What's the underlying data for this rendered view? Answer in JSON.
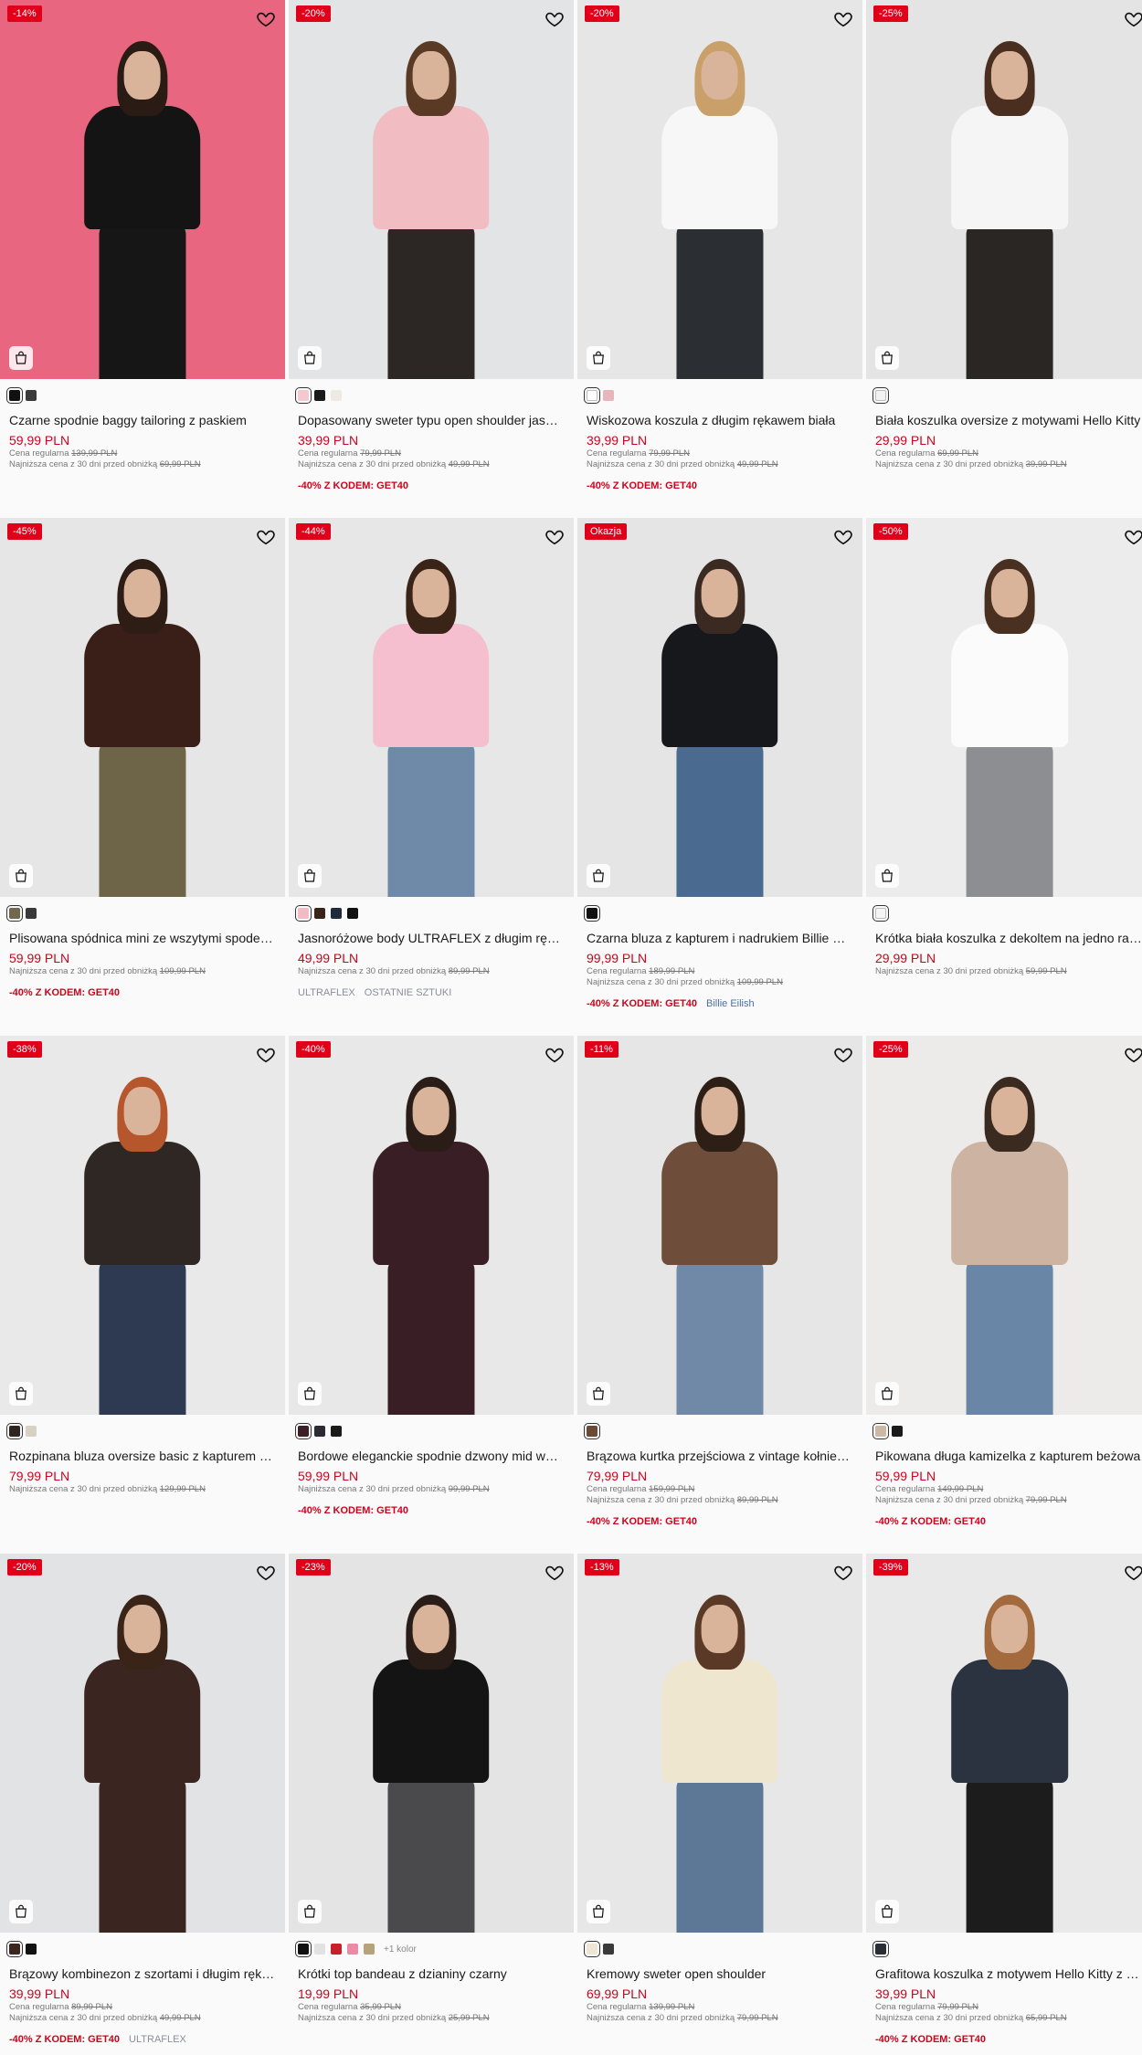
{
  "products": [
    {
      "discount": "-14%",
      "name": "Czarne spodnie baggy tailoring z paskiem",
      "price": "59,99 PLN",
      "regular_label": "Cena regularna",
      "regular": "139,99 PLN",
      "lowest_label": "Najniższa cena z 30 dni przed obniżką",
      "lowest": "69,99 PLN",
      "promo": "",
      "tags": [],
      "swatches": [
        "#111111",
        "#3a3a3a"
      ],
      "more": "",
      "bg": "#e8667f",
      "hair": "#2a1b14",
      "top": "#141414",
      "bottom": "#161616"
    },
    {
      "discount": "-20%",
      "name": "Dopasowany sweter typu open shoulder jasnoróżowy",
      "price": "39,99 PLN",
      "regular_label": "Cena regularna",
      "regular": "79,99 PLN",
      "lowest_label": "Najniższa cena z 30 dni przed obniżką",
      "lowest": "49,99 PLN",
      "promo": "-40% Z KODEM: GET40",
      "tags": [],
      "swatches": [
        "#f3c9cf",
        "#1a1a1a",
        "#eeeae3"
      ],
      "more": "",
      "bg": "#e3e4e6",
      "hair": "#5a3a24",
      "top": "#f2bcc3",
      "bottom": "#2c2624"
    },
    {
      "discount": "-20%",
      "name": "Wiskozowa koszula z długim rękawem biała",
      "price": "39,99 PLN",
      "regular_label": "Cena regularna",
      "regular": "79,99 PLN",
      "lowest_label": "Najniższa cena z 30 dni przed obniżką",
      "lowest": "49,99 PLN",
      "promo": "-40% Z KODEM: GET40",
      "tags": [],
      "swatches": [
        "#ffffff",
        "#e7b6ba"
      ],
      "more": "",
      "bg": "#e6e6e6",
      "hair": "#c9a06a",
      "top": "#f7f7f7",
      "bottom": "#2b2e33"
    },
    {
      "discount": "-25%",
      "name": "Biała koszulka oversize z motywami Hello Kitty",
      "price": "29,99 PLN",
      "regular_label": "Cena regularna",
      "regular": "69,99 PLN",
      "lowest_label": "Najniższa cena z 30 dni przed obniżką",
      "lowest": "39,99 PLN",
      "promo": "",
      "tags": [],
      "swatches": [
        "#f2f2f2"
      ],
      "more": "",
      "bg": "#e4e4e4",
      "hair": "#4a2e20",
      "top": "#f5f5f5",
      "bottom": "#2a2623"
    },
    {
      "discount": "-45%",
      "name": "Plisowana spódnica mini ze wszytymi spodenkami",
      "price": "59,99 PLN",
      "regular_label": "",
      "regular": "",
      "lowest_label": "Najniższa cena z 30 dni przed obniżką",
      "lowest": "109,99 PLN",
      "promo": "-40% Z KODEM: GET40",
      "tags": [],
      "swatches": [
        "#6f6a4e",
        "#3a3a3a"
      ],
      "more": "",
      "bg": "#e6e6e6",
      "hair": "#2d1d14",
      "top": "#3a1f18",
      "bottom": "#6e6448"
    },
    {
      "discount": "-44%",
      "name": "Jasnoróżowe body ULTRAFLEX z długim rękawem",
      "price": "49,99 PLN",
      "regular_label": "",
      "regular": "",
      "lowest_label": "Najniższa cena z 30 dni przed obniżką",
      "lowest": "89,99 PLN",
      "promo": "",
      "tags": [
        "ULTRAFLEX",
        "OSTATNIE SZTUKI"
      ],
      "swatches": [
        "#f2bcc6",
        "#3a2418",
        "#1f2a3a",
        "#111111"
      ],
      "more": "",
      "bg": "#e7e7e7",
      "hair": "#3a2418",
      "top": "#f6bfd0",
      "bottom": "#6e8aa8"
    },
    {
      "discount": "Okazja",
      "name": "Czarna bluza z kapturem i nadrukiem Billie Eilish",
      "price": "99,99 PLN",
      "regular_label": "Cena regularna",
      "regular": "189,99 PLN",
      "lowest_label": "Najniższa cena z 30 dni przed obniżką",
      "lowest": "109,99 PLN",
      "promo": "-40% Z KODEM: GET40",
      "tags": [
        "Billie Eilish"
      ],
      "swatches": [
        "#111111"
      ],
      "more": "",
      "bg": "#e5e5e5",
      "hair": "#3a2a22",
      "top": "#16181c",
      "bottom": "#4a6a90"
    },
    {
      "discount": "-50%",
      "name": "Krótka biała koszulka z dekoltem na jedno ramię",
      "price": "29,99 PLN",
      "regular_label": "",
      "regular": "",
      "lowest_label": "Najniższa cena z 30 dni przed obniżką",
      "lowest": "59,99 PLN",
      "promo": "",
      "tags": [],
      "swatches": [
        "#f4f4f4"
      ],
      "more": "",
      "bg": "#ececec",
      "hair": "#4a3020",
      "top": "#fbfbfb",
      "bottom": "#8c8e92"
    },
    {
      "discount": "-38%",
      "name": "Rozpinana bluza oversize basic z kapturem brązowa",
      "price": "79,99 PLN",
      "regular_label": "",
      "regular": "",
      "lowest_label": "Najniższa cena z 30 dni przed obniżką",
      "lowest": "129,99 PLN",
      "promo": "",
      "tags": [],
      "swatches": [
        "#2e2420",
        "#d6d1c3"
      ],
      "more": "",
      "bg": "#e9e9e9",
      "hair": "#b5562c",
      "top": "#2f2723",
      "bottom": "#2d3a52"
    },
    {
      "discount": "-40%",
      "name": "Bordowe eleganckie spodnie dzwony mid waist",
      "price": "59,99 PLN",
      "regular_label": "",
      "regular": "",
      "lowest_label": "Najniższa cena z 30 dni przed obniżką",
      "lowest": "99,99 PLN",
      "promo": "-40% Z KODEM: GET40",
      "tags": [],
      "swatches": [
        "#3d1f27",
        "#2a2b33",
        "#1a1a1a"
      ],
      "more": "",
      "bg": "#e8e8e8",
      "hair": "#2a1c16",
      "top": "#3a1e26",
      "bottom": "#3a1e26"
    },
    {
      "discount": "-11%",
      "name": "Brązowa kurtka przejściowa z vintage kołnierzem",
      "price": "79,99 PLN",
      "regular_label": "Cena regularna",
      "regular": "159,99 PLN",
      "lowest_label": "Najniższa cena z 30 dni przed obniżką",
      "lowest": "89,99 PLN",
      "promo": "-40% Z KODEM: GET40",
      "tags": [],
      "swatches": [
        "#6b4a35"
      ],
      "more": "",
      "bg": "#e6e6e6",
      "hair": "#2d1e16",
      "top": "#6e4e3a",
      "bottom": "#6f89a6"
    },
    {
      "discount": "-25%",
      "name": "Pikowana długa kamizelka z kapturem beżowa",
      "price": "59,99 PLN",
      "regular_label": "Cena regularna",
      "regular": "149,99 PLN",
      "lowest_label": "Najniższa cena z 30 dni przed obniżką",
      "lowest": "79,99 PLN",
      "promo": "-40% Z KODEM: GET40",
      "tags": [],
      "swatches": [
        "#cdb8a5",
        "#1a1a1a"
      ],
      "more": "",
      "bg": "#ecebea",
      "hair": "#3a2a20",
      "top": "#ccb3a2",
      "bottom": "#6a86a6"
    },
    {
      "discount": "-20%",
      "name": "Brązowy kombinezon z szortami i długim rękawem",
      "price": "39,99 PLN",
      "regular_label": "Cena regularna",
      "regular": "89,99 PLN",
      "lowest_label": "Najniższa cena z 30 dni przed obniżką",
      "lowest": "49,99 PLN",
      "promo": "-40% Z KODEM: GET40",
      "tags": [
        "ULTRAFLEX"
      ],
      "swatches": [
        "#3a2620",
        "#111111"
      ],
      "more": "",
      "bg": "#e2e3e5",
      "hair": "#3a2418",
      "top": "#3b2520",
      "bottom": "#3b2520"
    },
    {
      "discount": "-23%",
      "name": "Krótki top bandeau z dzianiny czarny",
      "price": "19,99 PLN",
      "regular_label": "Cena regularna",
      "regular": "35,99 PLN",
      "lowest_label": "Najniższa cena z 30 dni przed obniżką",
      "lowest": "25,99 PLN",
      "promo": "",
      "tags": [],
      "swatches": [
        "#111111",
        "#e2e2e2",
        "#c8202a",
        "#e98aa7",
        "#b7a27e"
      ],
      "more": "+1 kolor",
      "bg": "#e4e4e4",
      "hair": "#2a1d17",
      "top": "#141414",
      "bottom": "#4a4a4c"
    },
    {
      "discount": "-13%",
      "name": "Kremowy sweter open shoulder",
      "price": "69,99 PLN",
      "regular_label": "Cena regularna",
      "regular": "139,99 PLN",
      "lowest_label": "Najniższa cena z 30 dni przed obniżką",
      "lowest": "79,99 PLN",
      "promo": "",
      "tags": [],
      "swatches": [
        "#ede6d3",
        "#3a3a3a"
      ],
      "more": "",
      "bg": "#e7e7e7",
      "hair": "#5a3a26",
      "top": "#efe6cf",
      "bottom": "#5c7896"
    },
    {
      "discount": "-39%",
      "name": "Grafitowa koszulka z motywem Hello Kitty z aplikacją",
      "price": "39,99 PLN",
      "regular_label": "Cena regularna",
      "regular": "79,99 PLN",
      "lowest_label": "Najniższa cena z 30 dni przed obniżką",
      "lowest": "65,99 PLN",
      "promo": "-40% Z KODEM: GET40",
      "tags": [],
      "swatches": [
        "#2a2e36"
      ],
      "more": "",
      "bg": "#e9e9e9",
      "hair": "#a36a3d",
      "top": "#2c3340",
      "bottom": "#1c1c1c"
    }
  ]
}
